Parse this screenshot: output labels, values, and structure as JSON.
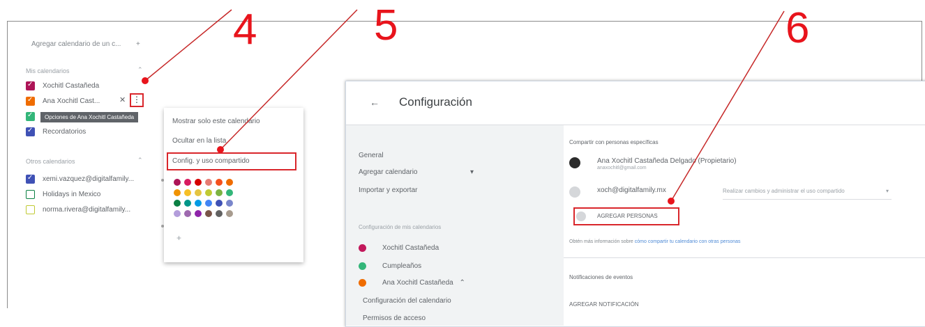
{
  "colors": {
    "accent_red": "#e8141c",
    "highlight": "#d9262b"
  },
  "callouts": [
    "4",
    "5",
    "6"
  ],
  "left_panel": {
    "add_calendar": "Agregar calendario de un c...",
    "add_icon": "plus-icon",
    "my_calendars_header": "Mis calendarios",
    "other_calendars_header": "Otros calendarios",
    "my_calendars": [
      {
        "label": "Xochitl Castañeda",
        "color": "#ad1457"
      },
      {
        "label": "Ana Xochitl Cast...",
        "color": "#ef6c00"
      },
      {
        "label": "Cumpleaños",
        "color": "#33b679"
      },
      {
        "label": "Recordatorios",
        "color": "#3f51b5"
      }
    ],
    "other_calendars": [
      {
        "label": "xemi.vazquez@digitalfamily...",
        "color": "#3f51b5",
        "checked": true
      },
      {
        "label": "Holidays in Mexico",
        "color": "#0b8043",
        "checked": false
      },
      {
        "label": "norma.rivera@digitalfamily...",
        "color": "#c0ca33",
        "checked": false
      }
    ],
    "tooltip": "Opciones de Ana Xochitl Castañeda",
    "close_icon": "close-icon",
    "more_icon": "more-vertical-icon"
  },
  "menu": {
    "items": [
      "Mostrar solo este calendario",
      "Ocultar en la lista",
      "Config. y uso compartido"
    ],
    "add_color_icon": "plus-icon",
    "palette": [
      "#ad1457",
      "#d81b60",
      "#d50000",
      "#e67c73",
      "#f4511e",
      "#ef6c00",
      "#f09300",
      "#f6bf26",
      "#e4c441",
      "#c0ca33",
      "#7cb342",
      "#33b679",
      "#0b8043",
      "#009688",
      "#039be5",
      "#4285f4",
      "#3f51b5",
      "#7986cb",
      "#b39ddb",
      "#9e69af",
      "#8e24aa",
      "#795548",
      "#616161",
      "#a79b8e"
    ]
  },
  "settings": {
    "back_icon": "arrow-left-icon",
    "title": "Configuración",
    "sidebar": {
      "items": [
        "General",
        "Agregar calendario",
        "Importar y exportar"
      ],
      "expand_icon": "chevron-down-icon",
      "section_caption": "Configuración de mis calendarios",
      "calendars": [
        {
          "label": "Xochitl Castañeda",
          "color": "#c2185b"
        },
        {
          "label": "Cumpleaños",
          "color": "#33b679"
        },
        {
          "label": "Ana Xochitl Castañeda",
          "color": "#ef6c00"
        }
      ],
      "collapse_icon": "chevron-up-icon",
      "subitems": [
        "Configuración del calendario",
        "Permisos de acceso"
      ]
    },
    "share": {
      "header": "Compartir con personas específicas",
      "owner_name": "Ana Xochitl Castañeda Delgado (Propietario)",
      "owner_email": "anaxochitl@gmail.com",
      "person_email": "xoch@digitalfamily.mx",
      "permission": "Realizar cambios y administrar el uso compartido",
      "add_people": "AGREGAR PERSONAS",
      "info": "Obtén más información sobre",
      "info_link": "cómo compartir tu calendario con otras personas"
    },
    "notifications": {
      "header": "Notificaciones de eventos",
      "add": "AGREGAR NOTIFICACIÓN"
    }
  }
}
